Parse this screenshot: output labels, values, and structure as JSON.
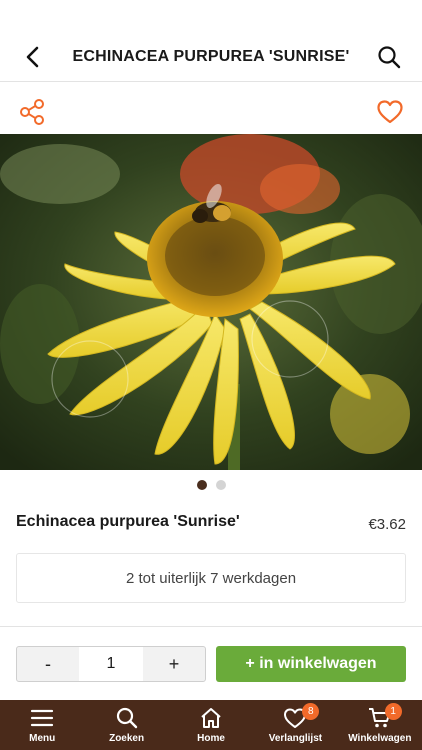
{
  "header": {
    "title": "ECHINACEA PURPUREA 'SUNRISE'",
    "back_icon": "chevron-left-icon",
    "search_icon": "search-icon"
  },
  "actions": {
    "share_icon": "share-icon",
    "favorite_icon": "heart-outline-icon"
  },
  "colors": {
    "accent_orange": "#f26a2a",
    "brand_brown": "#4a2a1a",
    "cart_green": "#6aab3a"
  },
  "carousel": {
    "total": 2,
    "active_index": 0
  },
  "product": {
    "name": "Echinacea purpurea 'Sunrise'",
    "price": "€3.62",
    "delivery": "2 tot uiterlijk 7 werkdagen"
  },
  "purchase": {
    "minus_label": "-",
    "quantity": "1",
    "plus_label": "+",
    "add_to_cart_label": "+ in winkelwagen"
  },
  "tabbar": {
    "items": [
      {
        "label": "Menu",
        "icon": "menu-icon"
      },
      {
        "label": "Zoeken",
        "icon": "search-icon"
      },
      {
        "label": "Home",
        "icon": "home-icon"
      },
      {
        "label": "Verlanglijst",
        "icon": "heart-icon",
        "badge": "8"
      },
      {
        "label": "Winkelwagen",
        "icon": "cart-icon",
        "badge": "1"
      }
    ]
  }
}
